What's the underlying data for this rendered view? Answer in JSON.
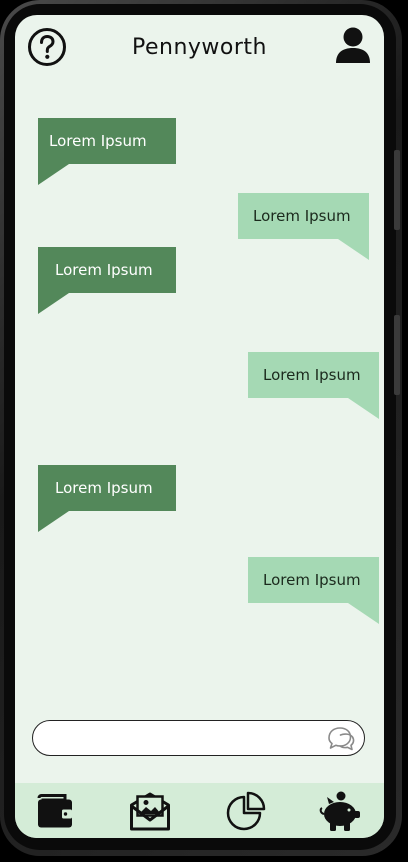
{
  "header": {
    "title": "Pennyworth",
    "help_icon": "help-circle-icon",
    "profile_icon": "user-icon"
  },
  "messages": [
    {
      "direction": "sent",
      "text": "Lorem Ipsum"
    },
    {
      "direction": "received",
      "text": "Lorem Ipsum"
    },
    {
      "direction": "sent",
      "text": "Lorem Ipsum"
    },
    {
      "direction": "received",
      "text": "Lorem Ipsum"
    },
    {
      "direction": "sent",
      "text": "Lorem Ipsum"
    },
    {
      "direction": "received",
      "text": "Lorem Ipsum"
    }
  ],
  "composer": {
    "placeholder": "",
    "value": "",
    "send_icon": "chat-bubbles-icon"
  },
  "bottom_nav": {
    "items": [
      {
        "icon": "wallet-icon"
      },
      {
        "icon": "mail-photo-icon"
      },
      {
        "icon": "pie-chart-icon"
      },
      {
        "icon": "piggy-bank-icon"
      }
    ]
  },
  "colors": {
    "screen_background": "#ebf4ec",
    "sent_bubble": "#53885a",
    "received_bubble": "#a5d9b4",
    "bottom_nav_background": "#d4ecd7"
  }
}
